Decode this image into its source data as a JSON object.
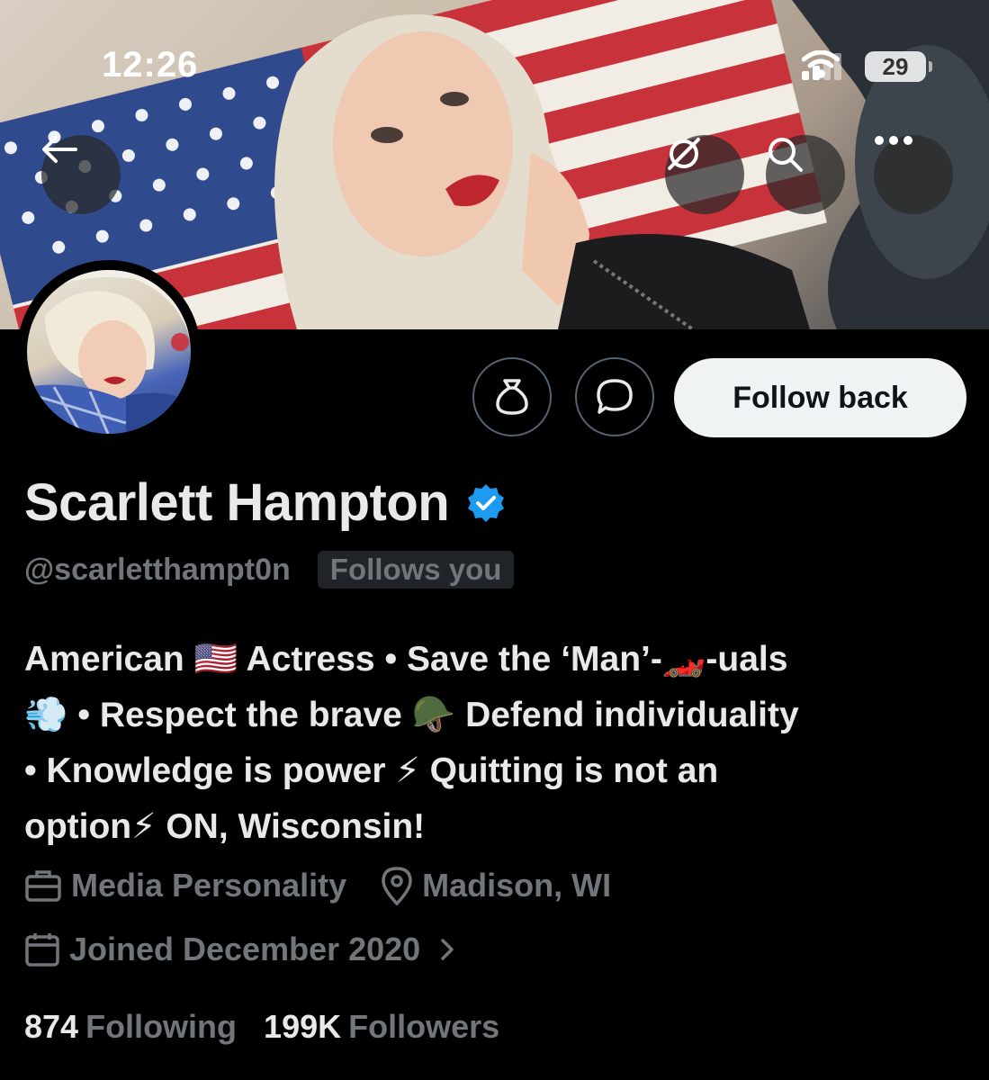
{
  "status_bar": {
    "time": "12:26",
    "battery": "29"
  },
  "banner": {
    "description_icon": "flag-banner"
  },
  "header_actions": {
    "back_icon": "arrow-left-icon",
    "grok_icon": "grok-icon",
    "search_icon": "search-icon",
    "more_icon": "more-icon"
  },
  "profile": {
    "name": "Scarlett Hampton",
    "verified": true,
    "handle": "@scarletthampt0n",
    "follows_you": "Follows you",
    "follow_button": "Follow back",
    "bio_lines": [
      "American 🇺🇸 Actress • Save the ‘Man’-🏎️-uals",
      "💨 • Respect the brave 🪖 Defend individuality",
      "• Knowledge is power ⚡ Quitting is not an",
      "option⚡ ON, Wisconsin!"
    ],
    "profession": "Media Personality",
    "location": "Madison, WI",
    "joined": "Joined December 2020",
    "following_count": "874",
    "following_label": "Following",
    "followers_count": "199K",
    "followers_label": "Followers"
  },
  "colors": {
    "background": "#000000",
    "verified": "#1d9bf0",
    "muted": "#71767b",
    "button_bg": "#eff3f4"
  }
}
